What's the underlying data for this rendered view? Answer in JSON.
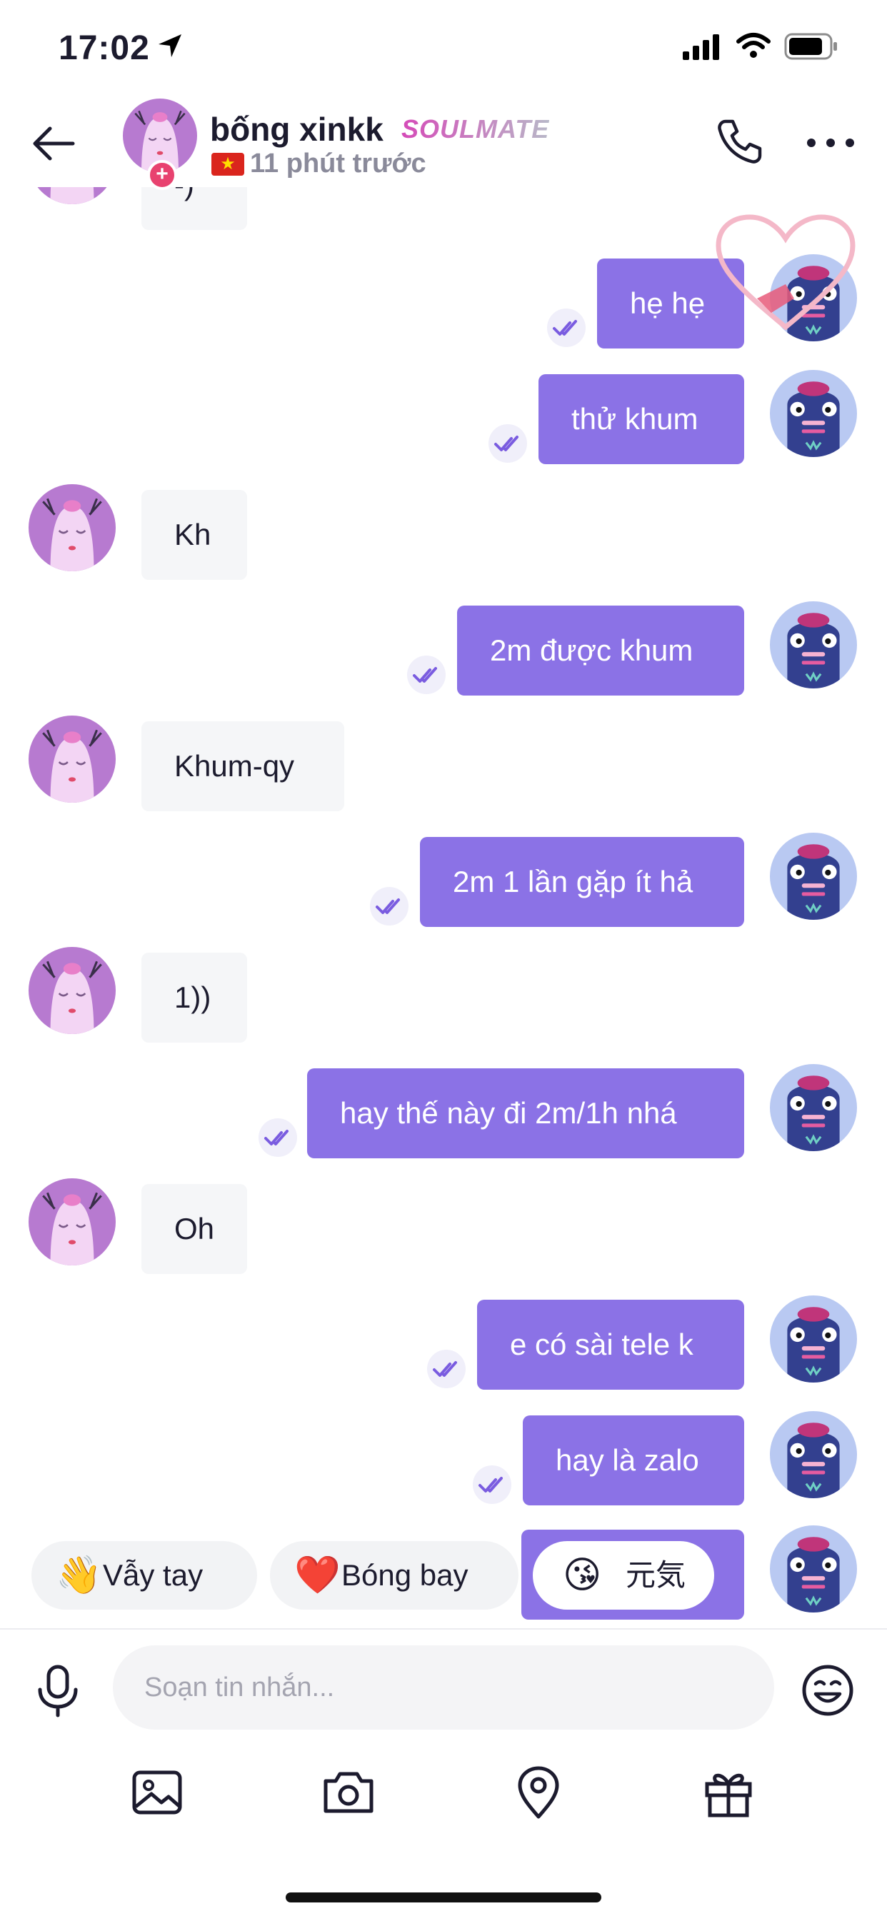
{
  "status_bar": {
    "time": "17:02"
  },
  "header": {
    "name": "bống xinkk",
    "badge": "SOULMATE",
    "flag": "★",
    "last_seen": "11 phút trước"
  },
  "messages": [
    {
      "side": "in",
      "text": "-)"
    },
    {
      "side": "out",
      "text": "hẹ hẹ"
    },
    {
      "side": "out",
      "text": "thử khum"
    },
    {
      "side": "in",
      "text": "Kh"
    },
    {
      "side": "out",
      "text": "2m được khum"
    },
    {
      "side": "in",
      "text": "Khum-qy"
    },
    {
      "side": "out",
      "text": "2m 1 lần gặp ít hả"
    },
    {
      "side": "in",
      "text": "1))"
    },
    {
      "side": "out",
      "text": "hay thế này đi 2m/1h nhá"
    },
    {
      "side": "in",
      "text": "Oh"
    },
    {
      "side": "out",
      "text": "e có sài tele k"
    },
    {
      "side": "out",
      "text": "hay là zalo"
    }
  ],
  "quick_replies": [
    {
      "emoji": "👋",
      "label": "Vẫy tay"
    },
    {
      "emoji": "❤️",
      "label": "Bóng bay"
    },
    {
      "emoji": "😘",
      "label": "元気"
    }
  ],
  "composer": {
    "placeholder": "Soạn tin nhắn..."
  },
  "toolbar": {
    "icons": [
      "image-icon",
      "camera-icon",
      "location-icon",
      "gift-icon"
    ]
  },
  "colors": {
    "outgoing": "#8b72e6",
    "incoming": "#f5f6f8",
    "accent": "#7a5ce0"
  }
}
